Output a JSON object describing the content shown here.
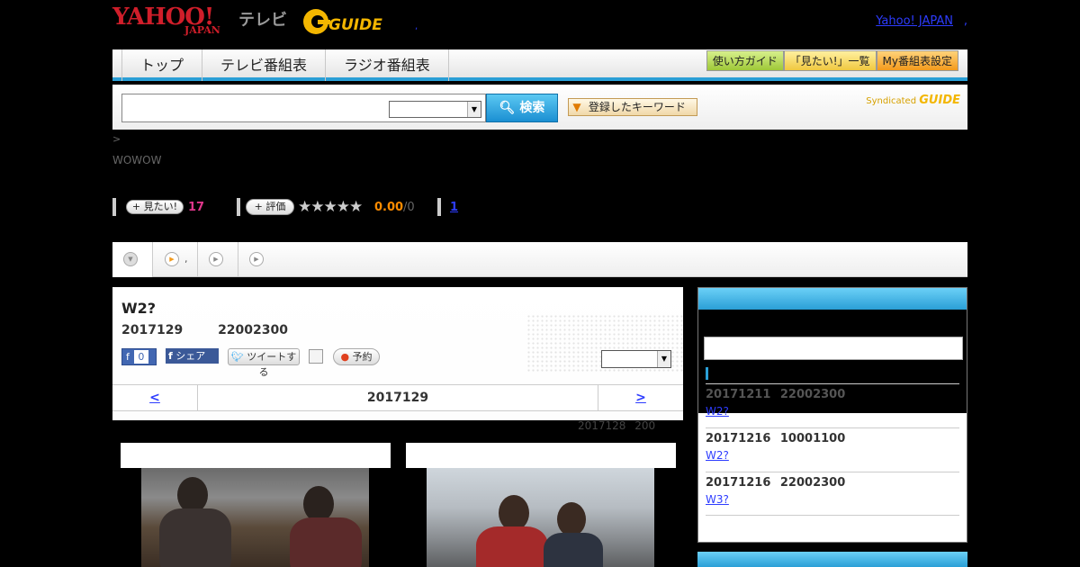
{
  "header": {
    "logo_yahoo": "YAHOO!",
    "logo_japan": "JAPAN",
    "logo_tv": "テレビ",
    "logo_gguide": "GUIDE",
    "yahoo_link": "Yahoo! JAPAN",
    "dot": ",",
    "small_dot": ","
  },
  "nav": {
    "tabs": [
      "トップ",
      "テレビ番組表",
      "ラジオ番組表"
    ],
    "buttons": [
      "使い方ガイド",
      "「見たい!」一覧",
      "My番組表設定"
    ]
  },
  "search": {
    "button_label": "検索",
    "keyword_button": "登録したキーワード",
    "syndicated": "Syndicated",
    "syndicated_logo": "GUIDE"
  },
  "breadcrumb": ">",
  "channel": "WOWOW",
  "stats": {
    "mitai_label": "見たい!",
    "mitai_count": "17",
    "hyoka_label": "評価",
    "stars": "★★★★★",
    "score": "0.00",
    "score_total": "/0",
    "review_count": "1"
  },
  "subtabs": [
    {
      "label": ""
    },
    {
      "label": ","
    },
    {
      "label": ""
    },
    {
      "label": ""
    }
  ],
  "program": {
    "title": "W2?",
    "date": "2017129 22002300",
    "like_label": "f",
    "like_count": "0",
    "fb_share": "シェア",
    "tweet": "ツイートする",
    "yoyaku": "予約",
    "nav_prev": "<",
    "nav_date": "2017129",
    "nav_next": ">",
    "prev_air": "2017128 200"
  },
  "sidebar": {
    "items": [
      {
        "date": "20171211 22002300",
        "title": "W2?"
      },
      {
        "date": "20171216 10001100",
        "title": "W2?"
      },
      {
        "date": "20171216 22002300",
        "title": "W3?"
      }
    ]
  }
}
